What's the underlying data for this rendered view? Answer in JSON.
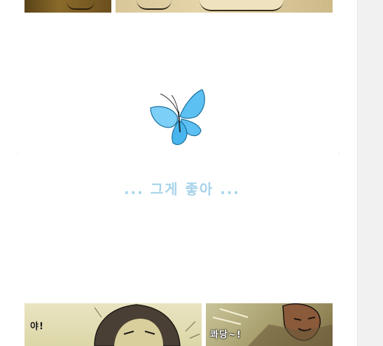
{
  "comic": {
    "caption": "... 그게 좋아 ...",
    "sfx_left": "야!",
    "sfx_right": "콰당~!"
  },
  "icons": {
    "butterfly": "blue-butterfly-icon"
  },
  "colors": {
    "caption": "#a7d3ea",
    "butterfly": "#5cc1f2"
  }
}
